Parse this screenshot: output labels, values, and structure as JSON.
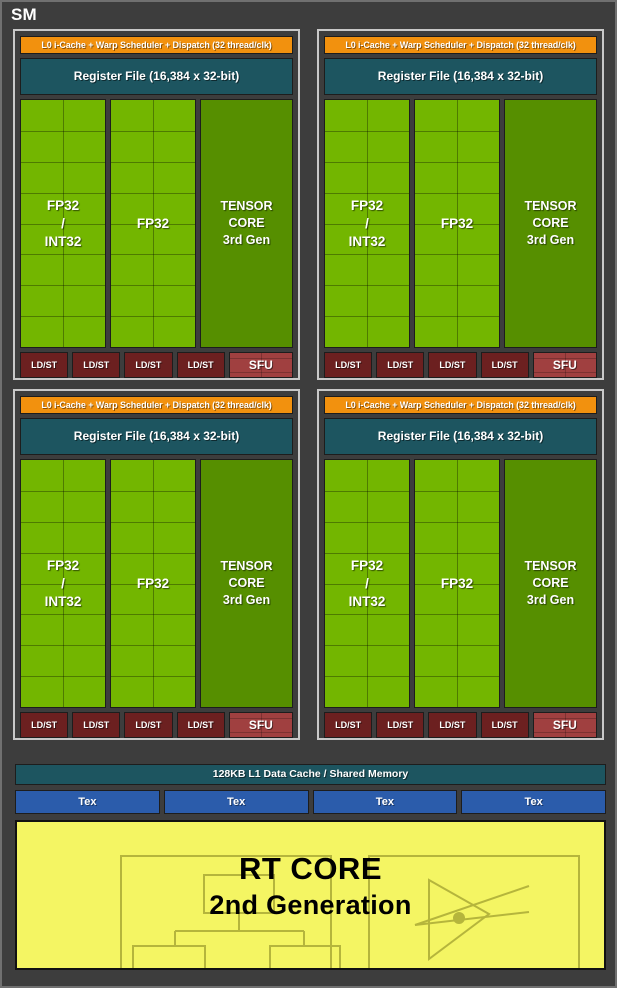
{
  "chip": {
    "title": "SM",
    "background_color": "#3d3d3d",
    "border_color": "#707070"
  },
  "partition": {
    "scheduler_label": "L0 i-Cache + Warp Scheduler + Dispatch (32 thread/clk)",
    "scheduler_color": "#f2910e",
    "register_file_label": "Register File (16,384 x 32-bit)",
    "register_file_color": "#1d5560",
    "fp32_int32_label_line1": "FP32",
    "fp32_int32_label_line2": "/",
    "fp32_int32_label_line3": "INT32",
    "fp32_label": "FP32",
    "fp32_color": "#73b600",
    "tensor_label_line1": "TENSOR",
    "tensor_label_line2": "CORE",
    "tensor_label_line3": "3rd Gen",
    "tensor_color": "#568f00",
    "ldst_label": "LD/ST",
    "ldst_color": "#6c2020",
    "ldst_count": 4,
    "sfu_label": "SFU",
    "sfu_color": "#a04040",
    "fp32_grid_columns": 2,
    "fp32_grid_rows": 8
  },
  "partitions": [
    {
      "id": "partition-0"
    },
    {
      "id": "partition-1"
    },
    {
      "id": "partition-2"
    },
    {
      "id": "partition-3"
    }
  ],
  "l1_cache": {
    "label": "128KB L1 Data Cache / Shared Memory",
    "color": "#1d5560"
  },
  "tex_units": {
    "label": "Tex",
    "color": "#2b5cab",
    "count": 4
  },
  "rt_core": {
    "line1": "RT CORE",
    "line2": "2nd Generation",
    "background_color": "#f4f563",
    "diagram_stroke_color": "#b5b53c",
    "text_color": "#000000"
  }
}
